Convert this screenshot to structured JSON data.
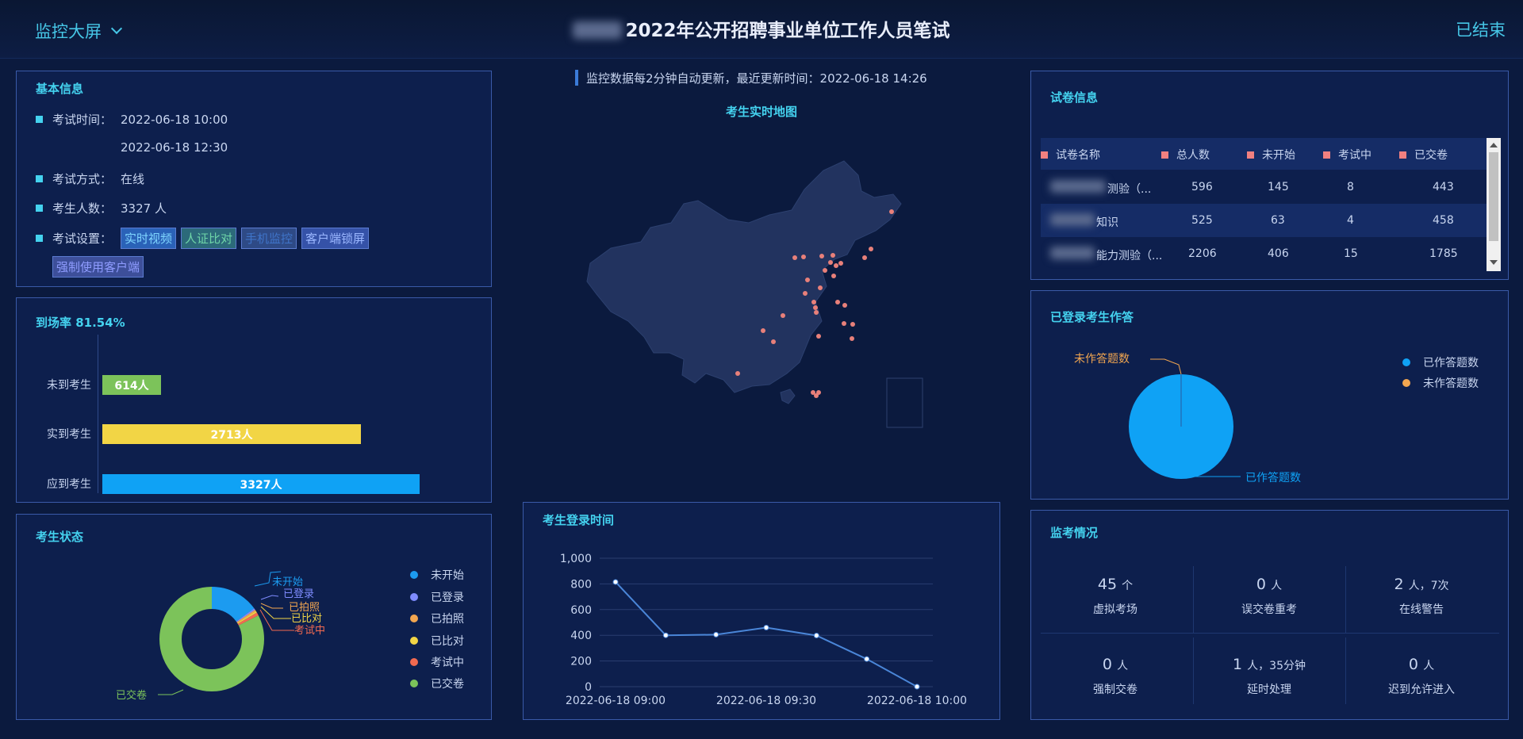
{
  "header": {
    "menu_label": "监控大屏",
    "title": "2022年公开招聘事业单位工作人员笔试",
    "status": "已结束"
  },
  "basic_info": {
    "title": "基本信息",
    "rows": [
      {
        "label": "考试时间：",
        "value": "2022-06-18 10:00"
      },
      {
        "label": "",
        "value": "2022-06-18 12:30"
      },
      {
        "label": "考试方式：",
        "value": "在线"
      },
      {
        "label": "考生人数：",
        "value": "3327 人"
      },
      {
        "label": "考试设置：",
        "value": ""
      }
    ],
    "tags": [
      "实时视频",
      "人证比对",
      "手机监控",
      "客户端锁屏",
      "强制使用客户端"
    ]
  },
  "attendance": {
    "title": "到场率 81.54%",
    "bars": [
      {
        "label": "未到考生",
        "value": 614,
        "text": "614人",
        "color": "#7cc35a"
      },
      {
        "label": "实到考生",
        "value": 2713,
        "text": "2713人",
        "color": "#f2d545"
      },
      {
        "label": "应到考生",
        "value": 3327,
        "text": "3327人",
        "color": "#0fa2f5"
      }
    ],
    "max": 3327
  },
  "candidate_status": {
    "title": "考生状态",
    "legend": [
      {
        "name": "未开始",
        "color": "#1c9bf0"
      },
      {
        "name": "已登录",
        "color": "#7f8cff"
      },
      {
        "name": "已拍照",
        "color": "#f2a650"
      },
      {
        "name": "已比对",
        "color": "#f2d545"
      },
      {
        "name": "考试中",
        "color": "#f26a50"
      },
      {
        "name": "已交卷",
        "color": "#7cc35a"
      }
    ],
    "slices": [
      0.15,
      0.005,
      0.005,
      0.005,
      0.01,
      0.825
    ]
  },
  "notice": "监控数据每2分钟自动更新，最近更新时间：2022-06-18 14:26",
  "map": {
    "title": "考生实时地图"
  },
  "login_time": {
    "title": "考生登录时间",
    "x_ticks": [
      "2022-06-18 09:00",
      "2022-06-18 09:30",
      "2022-06-18 10:00"
    ],
    "y_ticks": [
      "1,000",
      "800",
      "600",
      "400",
      "200",
      "0"
    ]
  },
  "chart_data": {
    "type": "line",
    "title": "考生登录时间",
    "x": [
      "2022-06-18 09:00",
      "2022-06-18 09:10",
      "2022-06-18 09:20",
      "2022-06-18 09:30",
      "2022-06-18 09:40",
      "2022-06-18 09:50",
      "2022-06-18 10:00"
    ],
    "series": [
      {
        "values": [
          815,
          400,
          405,
          460,
          398,
          215,
          0
        ]
      }
    ],
    "ylim": [
      0,
      1000
    ],
    "grid": true
  },
  "paper_info": {
    "title": "试卷信息",
    "columns": [
      "试卷名称",
      "总人数",
      "未开始",
      "考试中",
      "已交卷"
    ],
    "rows": [
      {
        "name": "测验（...",
        "total": "596",
        "not_started": "145",
        "in_exam": "8",
        "submitted": "443"
      },
      {
        "name": "知识",
        "total": "525",
        "not_started": "63",
        "in_exam": "4",
        "submitted": "458"
      },
      {
        "name": "能力测验（...",
        "total": "2206",
        "not_started": "406",
        "in_exam": "15",
        "submitted": "1785"
      }
    ]
  },
  "answering": {
    "title": "已登录考生作答",
    "legend": [
      {
        "name": "已作答题数",
        "color": "#0fa2f5"
      },
      {
        "name": "未作答题数",
        "color": "#f2a650"
      }
    ],
    "label_answered": "已作答题数",
    "label_unanswered": "未作答题数"
  },
  "monitoring": {
    "title": "监考情况",
    "cells": [
      {
        "value": "45",
        "unit": "个",
        "label": "虚拟考场"
      },
      {
        "value": "0",
        "unit": "人",
        "label": "误交卷重考"
      },
      {
        "value": "2",
        "unit": "人，7次",
        "label": "在线警告"
      },
      {
        "value": "0",
        "unit": "人",
        "label": "强制交卷"
      },
      {
        "value": "1",
        "unit": "人，35分钟",
        "label": "延时处理"
      },
      {
        "value": "0",
        "unit": "人",
        "label": "迟到允许进入"
      }
    ]
  }
}
